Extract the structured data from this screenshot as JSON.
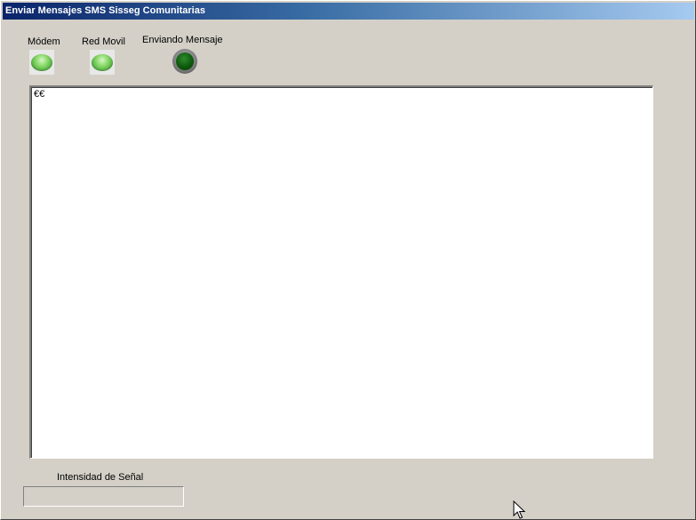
{
  "window": {
    "title": "Enviar Mensajes SMS Sisseg Comunitarias"
  },
  "indicators": [
    {
      "label": "Módem",
      "state": "on",
      "color": "#6cc24a"
    },
    {
      "label": "Red Movil",
      "state": "on",
      "color": "#6cc24a"
    },
    {
      "label": "Enviando Mensaje",
      "state": "off",
      "color": "#0d5a0d"
    }
  ],
  "log": {
    "text": "€€"
  },
  "signal": {
    "label": "Intensidad de Señal",
    "level": 0
  },
  "colors": {
    "window_bg": "#d4d0c8",
    "title_start": "#0a246a",
    "title_end": "#a6caf0"
  }
}
